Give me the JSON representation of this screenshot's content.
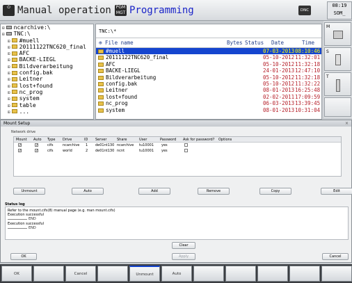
{
  "header": {
    "mode1_icon": "⏻",
    "mode1_title": "Manual operation",
    "mode2_icon": "PGM MGT",
    "mode2_title": "Programming",
    "dnc_label": "DNC",
    "clock_time": "08:19",
    "clock_sub": "SOM_"
  },
  "tree": [
    {
      "label": "ncarchive:\\",
      "kind": "drive"
    },
    {
      "label": "TNC:\\",
      "kind": "drive"
    },
    {
      "label": "#muell",
      "kind": "folder"
    },
    {
      "label": "20111122TNC620_final",
      "kind": "folder"
    },
    {
      "label": "AFC",
      "kind": "folder"
    },
    {
      "label": "BACKE-LIEGL",
      "kind": "folder"
    },
    {
      "label": "Bildverarbeitung",
      "kind": "folder"
    },
    {
      "label": "config.bak",
      "kind": "folder"
    },
    {
      "label": "Leitner",
      "kind": "folder"
    },
    {
      "label": "lost+found",
      "kind": "folder"
    },
    {
      "label": "nc_prog",
      "kind": "folder"
    },
    {
      "label": "system",
      "kind": "folder"
    },
    {
      "label": "table",
      "kind": "folder"
    },
    {
      "label": "...",
      "kind": "folder"
    }
  ],
  "files": {
    "path": "TNC:\\*",
    "col_name": "File name",
    "col_bytes": "Bytes",
    "col_status": "Status",
    "col_date": "Date",
    "col_time": "Time",
    "rows": [
      {
        "name": "#muell",
        "date": "07-03-2013",
        "time": "08:10:46"
      },
      {
        "name": "20111122TNC620_final",
        "date": "05-10-2012",
        "time": "11:32:01"
      },
      {
        "name": "AFC",
        "date": "05-10-2012",
        "time": "11:32:18"
      },
      {
        "name": "BACKE-LIEGL",
        "date": "24-01-2013",
        "time": "12:47:10"
      },
      {
        "name": "Bildverarbeitung",
        "date": "05-10-2012",
        "time": "11:32:18"
      },
      {
        "name": "config.bak",
        "date": "05-10-2012",
        "time": "11:32:22"
      },
      {
        "name": "Leitner",
        "date": "08-01-2013",
        "time": "16:25:48"
      },
      {
        "name": "lost+found",
        "date": "02-02-2011",
        "time": "17:09:59"
      },
      {
        "name": "nc_prog",
        "date": "06-03-2013",
        "time": "13:39:45"
      },
      {
        "name": "system",
        "date": "08-01-2013",
        "time": "10:31:04"
      }
    ]
  },
  "side": {
    "m_label": "M",
    "s_label": "S",
    "t_label": "T"
  },
  "mount": {
    "title": "Mount Setup",
    "close": "×",
    "group_label": "Network drive",
    "headers": {
      "mount": "Mount",
      "auto": "Auto",
      "type": "Type",
      "drive": "Drive",
      "id": "ID",
      "server": "Server",
      "share": "Share",
      "user": "User",
      "password": "Password",
      "ask": "Ask for password?",
      "options": "Options"
    },
    "rows": [
      {
        "mount": "✓",
        "auto": "✓",
        "type": "cifs",
        "drive": "ncarchive",
        "id": "1",
        "server": "de01nt130",
        "share": "ncarchive",
        "user": "tu10001",
        "password": "yes"
      },
      {
        "mount": "✓",
        "auto": "✓",
        "type": "cifs",
        "drive": "world",
        "id": "2",
        "server": "de01nt130",
        "share": "ncnt",
        "user": "tu10001",
        "password": "yes"
      }
    ],
    "buttons": {
      "unmount": "Unmount",
      "auto": "Auto",
      "add": "Add",
      "remove": "Remove",
      "copy": "Copy",
      "edit": "Edit",
      "clear": "Clear",
      "apply": "Apply",
      "ok": "OK",
      "cancel": "Cancel"
    },
    "log_label": "Status log",
    "log_lines": [
      "Refer to the mount.cifs(8) manual page (e.g. man mount.cifs)",
      "Execution successful",
      "END",
      "Execution successful",
      "END"
    ]
  },
  "softkeys": [
    "OK",
    "",
    "Cancel",
    "",
    "Unmount",
    "Auto",
    "",
    "",
    "",
    "",
    ""
  ]
}
